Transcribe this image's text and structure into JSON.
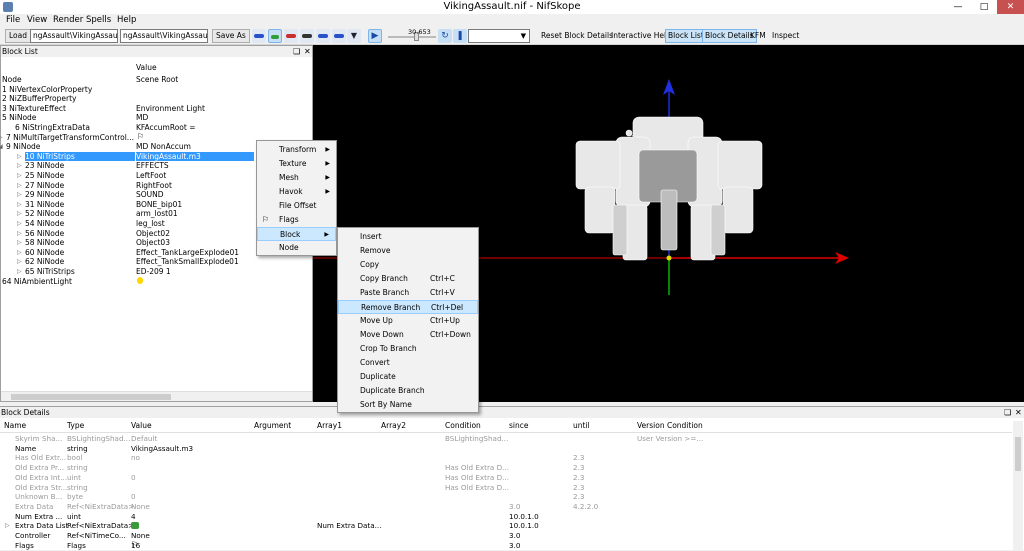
{
  "window": {
    "title": "VikingAssault.nif - NifSkope",
    "minimize": "—",
    "maximize": "□",
    "close": "✕"
  },
  "menu": [
    "File",
    "View",
    "Render",
    "Spells",
    "Help"
  ],
  "toolbar": {
    "load": "Load",
    "path1": "ngAssault\\VikingAssault.nif",
    "path2": "ngAssault\\VikingAssault.nif",
    "save_as": "Save As",
    "slider_value": "30.653",
    "reset_block_details": "Reset Block Details",
    "interactive_help": "Interactive Help",
    "block_list": "Block List",
    "block_details": "Block Details",
    "kfm": "KFM",
    "inspect": "Inspect"
  },
  "block_list": {
    "title": "Block List",
    "col_value": "Value",
    "rows": [
      {
        "name": "Node",
        "value": "Scene Root"
      },
      {
        "name": "1 NiVertexColorProperty",
        "value": ""
      },
      {
        "name": "2 NiZBufferProperty",
        "value": ""
      },
      {
        "name": "3 NiTextureEffect",
        "value": "Environment Light"
      },
      {
        "name": "5 NiNode",
        "value": "MD"
      },
      {
        "name": "6 NiStringExtraData",
        "value": "KFAccumRoot ="
      },
      {
        "name": "7 NiMultiTargetTransformControl...",
        "value": ""
      },
      {
        "name": "9 NiNode",
        "value": "MD NonAccum"
      },
      {
        "name": "10 NiTriStrips",
        "value": "VikingAssault.m3"
      },
      {
        "name": "23 NiNode",
        "value": "EFFECTS"
      },
      {
        "name": "25 NiNode",
        "value": "LeftFoot"
      },
      {
        "name": "27 NiNode",
        "value": "RightFoot"
      },
      {
        "name": "29 NiNode",
        "value": "SOUND"
      },
      {
        "name": "31 NiNode",
        "value": "BONE_bip01"
      },
      {
        "name": "52 NiNode",
        "value": "arm_lost01"
      },
      {
        "name": "54 NiNode",
        "value": "leg_lost"
      },
      {
        "name": "56 NiNode",
        "value": "Object02"
      },
      {
        "name": "58 NiNode",
        "value": "Object03"
      },
      {
        "name": "60 NiNode",
        "value": "Effect_TankLargeExplode01"
      },
      {
        "name": "62 NiNode",
        "value": "Effect_TankSmallExplode01"
      },
      {
        "name": "65 NiTriStrips",
        "value": "ED-209 1"
      },
      {
        "name": "64 NiAmbientLight",
        "value": ""
      }
    ]
  },
  "context_menu": {
    "items": [
      "Transform",
      "Texture",
      "Mesh",
      "Havok",
      "File Offset",
      "Flags",
      "Block",
      "Node"
    ]
  },
  "block_submenu": {
    "items": [
      {
        "label": "Insert",
        "shortcut": ""
      },
      {
        "label": "Remove",
        "shortcut": ""
      },
      {
        "label": "Copy",
        "shortcut": ""
      },
      {
        "label": "Copy Branch",
        "shortcut": "Ctrl+C"
      },
      {
        "label": "Paste Branch",
        "shortcut": "Ctrl+V"
      },
      {
        "label": "Remove Branch",
        "shortcut": "Ctrl+Del"
      },
      {
        "label": "Move Up",
        "shortcut": "Ctrl+Up"
      },
      {
        "label": "Move Down",
        "shortcut": "Ctrl+Down"
      },
      {
        "label": "Crop To Branch",
        "shortcut": ""
      },
      {
        "label": "Convert",
        "shortcut": ""
      },
      {
        "label": "Duplicate",
        "shortcut": ""
      },
      {
        "label": "Duplicate Branch",
        "shortcut": ""
      },
      {
        "label": "Sort By Name",
        "shortcut": ""
      }
    ]
  },
  "block_details": {
    "title": "Block Details",
    "headers": [
      "Name",
      "Type",
      "Value",
      "Argument",
      "Array1",
      "Array2",
      "Condition",
      "since",
      "until",
      "Version Condition"
    ],
    "rows": [
      {
        "name": "Skyrim Sha...",
        "type": "BSLightingShad...",
        "value": "Default",
        "argument": "",
        "array1": "",
        "condition": "BSLightingShad...",
        "since": "",
        "until": "",
        "vcond": "User Version >=..."
      },
      {
        "name": "Name",
        "type": "string",
        "value": "VikingAssault.m3",
        "argument": "",
        "array1": "",
        "condition": "",
        "since": "",
        "until": "",
        "vcond": ""
      },
      {
        "name": "Has Old Extr...",
        "type": "bool",
        "value": "no",
        "argument": "",
        "array1": "",
        "condition": "",
        "since": "",
        "until": "2.3",
        "vcond": ""
      },
      {
        "name": "Old Extra Pr...",
        "type": "string",
        "value": "",
        "argument": "",
        "array1": "",
        "condition": "Has Old Extra D...",
        "since": "",
        "until": "2.3",
        "vcond": ""
      },
      {
        "name": "Old Extra Int...",
        "type": "uint",
        "value": "0",
        "argument": "",
        "array1": "",
        "condition": "Has Old Extra D...",
        "since": "",
        "until": "2.3",
        "vcond": ""
      },
      {
        "name": "Old Extra Str...",
        "type": "string",
        "value": "",
        "argument": "",
        "array1": "",
        "condition": "Has Old Extra D...",
        "since": "",
        "until": "2.3",
        "vcond": ""
      },
      {
        "name": "Unknown B...",
        "type": "byte",
        "value": "0",
        "argument": "",
        "array1": "",
        "condition": "",
        "since": "",
        "until": "2.3",
        "vcond": ""
      },
      {
        "name": "Extra Data",
        "type": "Ref<NiExtraData>",
        "value": "None",
        "argument": "",
        "array1": "",
        "condition": "",
        "since": "3.0",
        "until": "4.2.2.0",
        "vcond": ""
      },
      {
        "name": "Num Extra ...",
        "type": "uint",
        "value": "4",
        "argument": "",
        "array1": "",
        "condition": "",
        "since": "10.0.1.0",
        "until": "",
        "vcond": ""
      },
      {
        "name": "Extra Data List",
        "type": "Ref<NiExtraData>",
        "value": "",
        "argument": "",
        "array1": "Num Extra Data...",
        "condition": "",
        "since": "10.0.1.0",
        "until": "",
        "vcond": ""
      },
      {
        "name": "Controller",
        "type": "Ref<NiTimeCo...",
        "value": "None",
        "argument": "",
        "array1": "",
        "condition": "",
        "since": "3.0",
        "until": "",
        "vcond": ""
      },
      {
        "name": "Flags",
        "type": "Flags",
        "value": "16",
        "argument": "",
        "array1": "",
        "condition": "",
        "since": "3.0",
        "until": "",
        "vcond": ""
      }
    ]
  },
  "colors": {
    "selection": "#3399ff",
    "axis_x": "#e00000",
    "axis_y": "#2030e0",
    "axis_z": "#00c000",
    "viewport_bg": "#000000"
  }
}
